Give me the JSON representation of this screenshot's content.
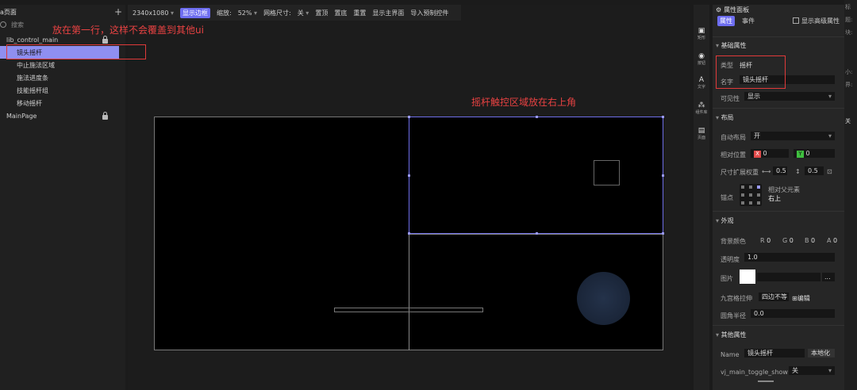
{
  "left_panel": {
    "title": "a页面",
    "add_label": "+",
    "search_placeholder": "搜索",
    "tree": [
      {
        "label": "lib_control_main",
        "locked": true
      },
      {
        "label": "镜头摇杆",
        "selected": true
      },
      {
        "label": "中止施法区域"
      },
      {
        "label": "施法进度条"
      },
      {
        "label": "技能摇杆组"
      },
      {
        "label": "移动摇杆"
      },
      {
        "label": "MainPage",
        "locked": true
      }
    ]
  },
  "annotations": {
    "first_row_note": "放在第一行，这样不会覆盖到其他ui",
    "joystick_note": "摇杆触控区域放在右上角"
  },
  "toolbar": {
    "resolution": "2340x1080",
    "show_border": "显示边框",
    "zoom_label": "缩放:",
    "zoom_value": "52%",
    "grid_label": "网格尺寸:",
    "grid_value": "关",
    "top": "置顶",
    "bottom": "置底",
    "reset": "重置",
    "show_main": "显示主界面",
    "import_prefab": "导入预制控件"
  },
  "tools": [
    {
      "name": "矩形"
    },
    {
      "name": "按钮"
    },
    {
      "name": "文字"
    },
    {
      "name": "组件库"
    },
    {
      "name": "页面"
    }
  ],
  "props": {
    "title": "属性面板",
    "tab_props": "属性",
    "tab_events": "事件",
    "show_advanced": "显示高级属性",
    "basic_section": "基础属性",
    "type_label": "类型",
    "type_value": "摇杆",
    "name_label": "名字",
    "name_value": "镜头摇杆",
    "visible_label": "可见性",
    "visible_value": "显示",
    "layout_section": "布局",
    "auto_layout_label": "自动布局",
    "auto_layout_value": "开",
    "rel_pos_label": "相对位置",
    "x_tag": "X",
    "x_value": "0",
    "y_tag": "Y",
    "y_value": "0",
    "size_weight_label": "尺寸扩展权重",
    "w_value": "0.5",
    "h_value": "0.5",
    "anchor_label": "锚点",
    "anchor_rel": "相对父元素",
    "anchor_value": "右上",
    "appearance_section": "外观",
    "bg_color_label": "背景颜色",
    "r_tag": "R",
    "r_value": "0",
    "g_tag": "G",
    "g_value": "0",
    "b_tag": "B",
    "b_value": "0",
    "a_tag": "A",
    "a_value": "0",
    "opacity_label": "透明度",
    "opacity_value": "1.0",
    "image_label": "图片",
    "image_more": "...",
    "nine_label": "九宫格拉伸",
    "nine_value": "四边不等",
    "nine_edit": "编辑",
    "radius_label": "圆角半径",
    "radius_value": "0.0",
    "other_section": "其他属性",
    "other_name_label": "Name",
    "other_name_value": "镜头摇杆",
    "localize": "本地化",
    "toggle_label": "vj_main_toggle_show",
    "toggle_value": "关"
  },
  "far_right": {
    "a": "标",
    "b": "题:",
    "c": "块:",
    "d": "小:",
    "e": "界:",
    "f": "关"
  },
  "colors": {
    "accent": "#6d6df0",
    "annotation": "#e03a3a",
    "selected_row": "#8f8ff0"
  }
}
